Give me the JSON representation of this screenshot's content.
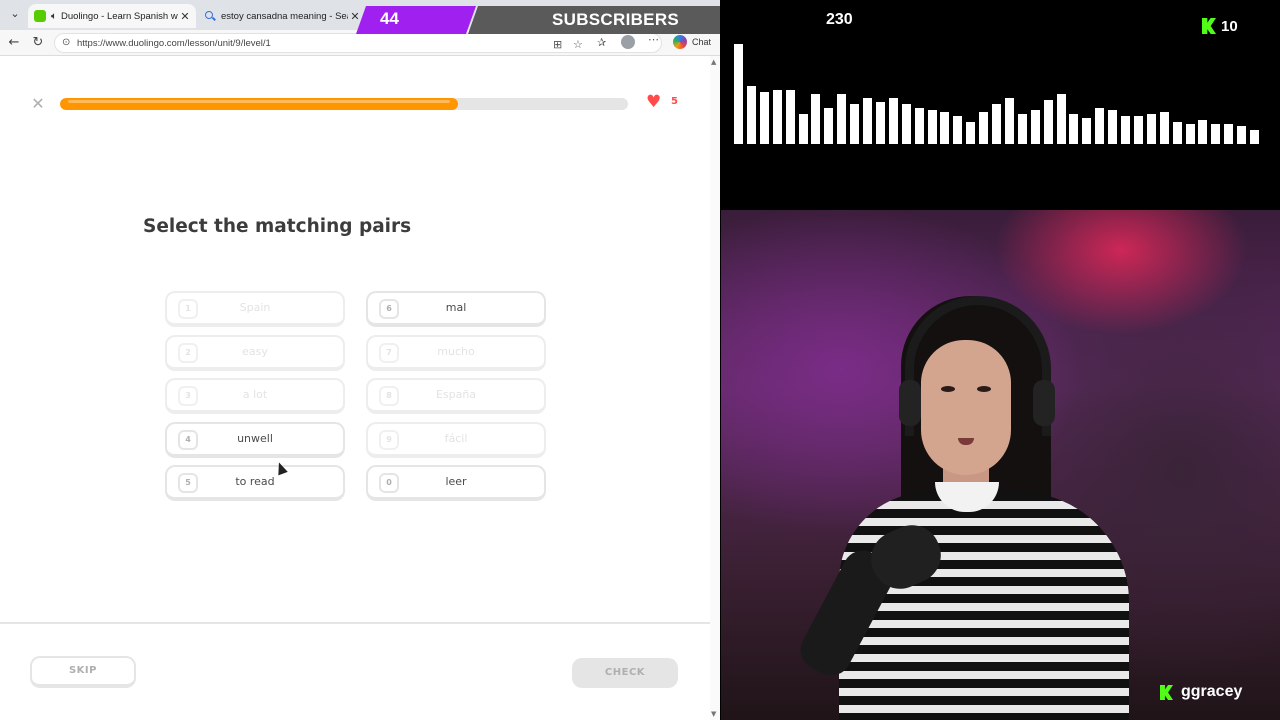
{
  "browser": {
    "tabs": [
      {
        "title": "Duolingo - Learn Spanish with",
        "active": true
      },
      {
        "title": "estoy cansadna meaning - Search",
        "active": false
      }
    ],
    "url": "https://www.duolingo.com/lesson/unit/9/level/1",
    "chat_label": "Chat"
  },
  "lesson": {
    "progress_percent": 70,
    "hearts": "5",
    "prompt": "Select the matching pairs",
    "left_options": [
      {
        "num": "1",
        "word": "Spain",
        "state": "matched"
      },
      {
        "num": "2",
        "word": "easy",
        "state": "matched"
      },
      {
        "num": "3",
        "word": "a lot",
        "state": "matched"
      },
      {
        "num": "4",
        "word": "unwell",
        "state": "active"
      },
      {
        "num": "5",
        "word": "to read",
        "state": "active"
      }
    ],
    "right_options": [
      {
        "num": "6",
        "word": "mal",
        "state": "active"
      },
      {
        "num": "7",
        "word": "mucho",
        "state": "matched"
      },
      {
        "num": "8",
        "word": "España",
        "state": "matched"
      },
      {
        "num": "9",
        "word": "fácil",
        "state": "matched"
      },
      {
        "num": "0",
        "word": "leer",
        "state": "active"
      }
    ],
    "skip_label": "SKIP",
    "check_label": "CHECK"
  },
  "overlay": {
    "subscriber_count": "44",
    "subscriber_label": "SUBSCRIBERS",
    "viewer_count": "230",
    "kick_count": "10",
    "streamer_handle": "ggracey",
    "colors": {
      "accent_purple": "#a020f0",
      "kick_green": "#53fc18",
      "duo_orange": "#ff9600",
      "heart_red": "#ff4b4b"
    }
  }
}
